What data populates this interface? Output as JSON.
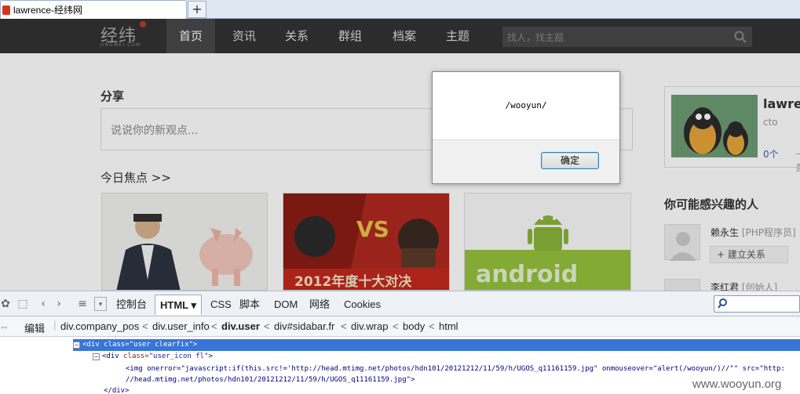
{
  "browser": {
    "tab_title": "lawrence-经纬网",
    "new_tab": "+"
  },
  "site": {
    "logo": "经纬",
    "logo_sub": "JINGWEI.COM",
    "nav": [
      "首页",
      "资讯",
      "关系",
      "群组",
      "档案",
      "主题"
    ],
    "search_placeholder": "找人，找主题",
    "share_title": "分享",
    "share_placeholder": "说说你的新观点...",
    "focus_title": "今日焦点 >>",
    "cards": [
      {
        "caption": ""
      },
      {
        "caption": "VS",
        "banner": "2012年度十大对决"
      },
      {
        "caption": "android"
      }
    ],
    "profile": {
      "name": "lawre",
      "role": "cto",
      "count": "0个",
      "count2": "一度"
    },
    "suggest_title": "你可能感兴趣的人",
    "people": [
      {
        "name": "赖永生",
        "role": "[PHP程序员]"
      },
      {
        "name": "李红君",
        "role": "[创始人]"
      }
    ],
    "connect_label": "+ 建立关系"
  },
  "dialog": {
    "message": "/wooyun/",
    "ok_label": "确定"
  },
  "firebug": {
    "tabs": [
      "控制台",
      "HTML ▾",
      "CSS",
      "脚本",
      "DOM",
      "网络",
      "Cookies"
    ],
    "edit_label": "编辑",
    "breadcrumbs": [
      "div.company_pos",
      "div.user_info",
      "div.user",
      "div#sidabar.fr",
      "div.wrap",
      "body",
      "html"
    ],
    "html_lines": [
      {
        "prefix": "<",
        "tag": "div",
        "attr": " class=",
        "val": "\"user clearfix\"",
        "suffix": ">"
      },
      {
        "prefix": "<",
        "tag": "div",
        "attr": " class=",
        "val": "\"user_icon fl\"",
        "suffix": ">"
      },
      {
        "text": "<img onerror=\"javascript:if(this.src!='http://head.mtimg.net/photos/hdn101/20121212/11/59/h/UGOS_q11161159.jpg\" onmouseover=\"alert(/wooyun/)//\"\" src=\"http:"
      },
      {
        "text": "//head.mtimg.net/photos/hdn101/20121212/11/59/h/UGOS_q11161159.jpg\">"
      },
      {
        "text": "</div>"
      }
    ]
  },
  "watermark": "www.wooyun.org"
}
